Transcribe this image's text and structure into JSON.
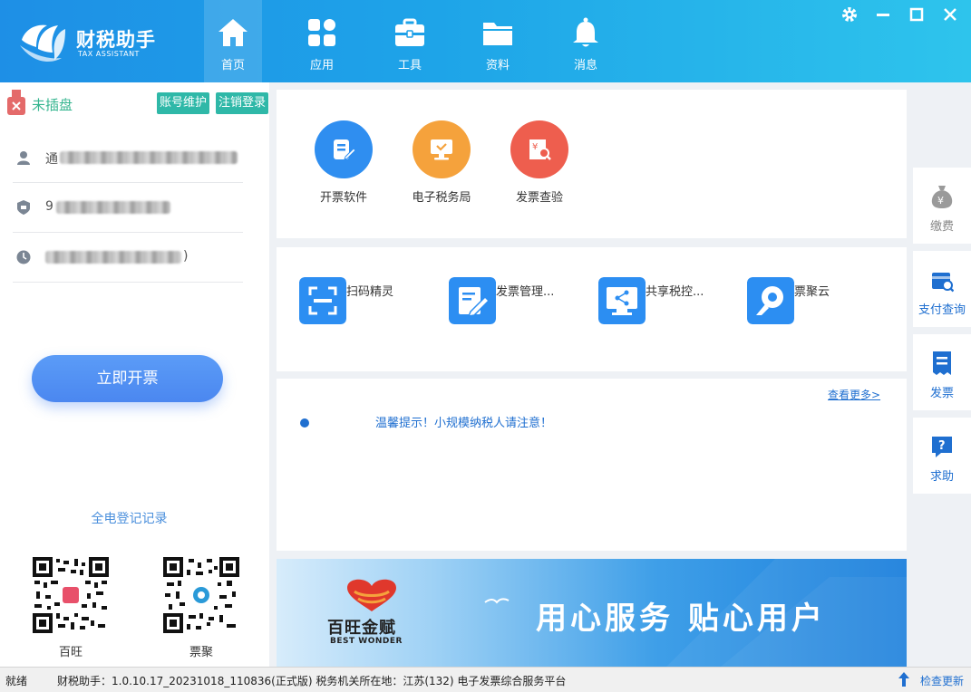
{
  "app": {
    "title": "财税助手",
    "subtitle": "TAX ASSISTANT"
  },
  "nav": [
    {
      "label": "首页",
      "icon": "home-icon",
      "active": true
    },
    {
      "label": "应用",
      "icon": "apps-icon",
      "active": false
    },
    {
      "label": "工具",
      "icon": "toolbox-icon",
      "active": false
    },
    {
      "label": "资料",
      "icon": "folder-icon",
      "active": false
    },
    {
      "label": "消息",
      "icon": "bell-icon",
      "active": false
    }
  ],
  "window_controls": [
    "gear-icon",
    "minimize-icon",
    "maximize-icon",
    "close-icon"
  ],
  "left": {
    "usb_status": "未插盘",
    "account_maintain": "账号维护",
    "logout": "注销登录",
    "info_rows": [
      {
        "icon": "user-icon",
        "prefix": "通",
        "tail": ""
      },
      {
        "icon": "id-badge-icon",
        "prefix": "9",
        "tail": ""
      },
      {
        "icon": "clock-icon",
        "prefix": "",
        "tail": ")"
      }
    ],
    "issue_button": "立即开票",
    "record_link": "全电登记记录",
    "qr_codes": [
      {
        "label": "百旺",
        "center": "#e8506a"
      },
      {
        "label": "票聚",
        "center": "#2a9ad8"
      }
    ]
  },
  "quick_apps": [
    {
      "label": "开票软件",
      "icon": "invoice-edit-icon",
      "color": "#2f8ef0"
    },
    {
      "label": "电子税务局",
      "icon": "monitor-icon",
      "color": "#f5a23c"
    },
    {
      "label": "发票查验",
      "icon": "invoice-search-icon",
      "color": "#ee5e4e"
    }
  ],
  "tools": [
    {
      "label": "扫码精灵",
      "icon": "scan-icon"
    },
    {
      "label": "发票管理...",
      "icon": "pen-note-icon"
    },
    {
      "label": "共享税控...",
      "icon": "share-screen-icon"
    },
    {
      "label": "票聚云",
      "icon": "cloud-key-icon"
    }
  ],
  "notice": {
    "more": "查看更多>",
    "items": [
      "温馨提示！小规模纳税人请注意！"
    ]
  },
  "banner": {
    "brand": "百旺金赋",
    "brand_en": "BEST WONDER",
    "slogan": "用心服务 贴心用户"
  },
  "rail": [
    {
      "label": "缴费",
      "icon": "money-bag-icon",
      "muted": true
    },
    {
      "label": "支付查询",
      "icon": "payment-search-icon",
      "muted": false
    },
    {
      "label": "发票",
      "icon": "receipt-icon",
      "muted": false
    },
    {
      "label": "求助",
      "icon": "help-chat-icon",
      "muted": false
    }
  ],
  "status": {
    "ready": "就绪",
    "version": "财税助手：1.0.10.17_20231018_110836(正式版) 税务机关所在地：江苏(132) 电子发票综合服务平台",
    "update": "检查更新"
  }
}
